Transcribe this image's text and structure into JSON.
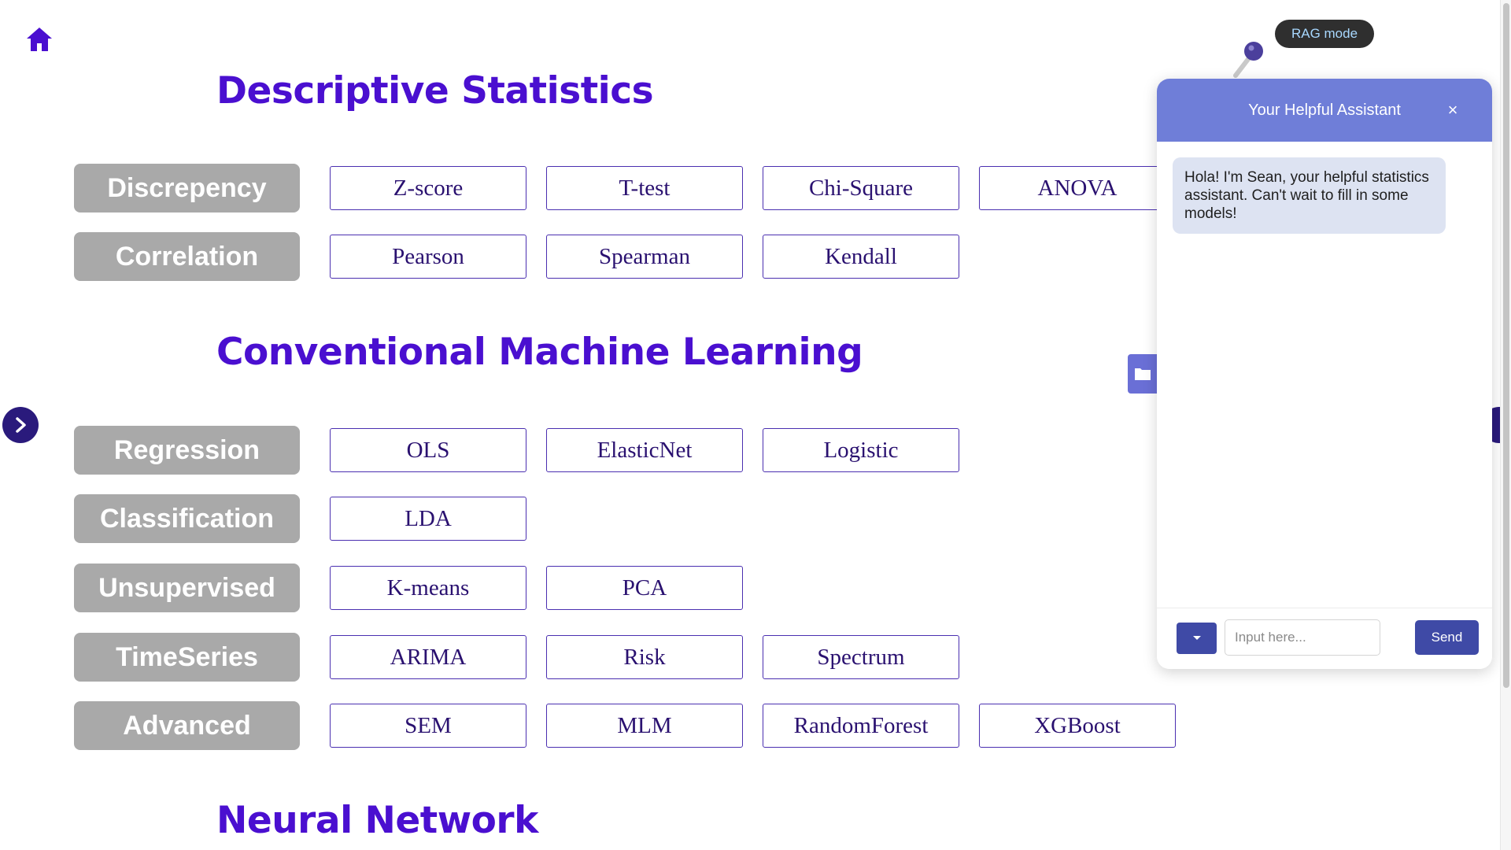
{
  "home": {
    "icon": "home-icon"
  },
  "sections": {
    "descriptive": "Descriptive Statistics",
    "conventional": "Conventional Machine Learning",
    "neural": "Neural Network"
  },
  "rows": {
    "discrepency": {
      "label": "Discrepency",
      "models": [
        "Z-score",
        "T-test",
        "Chi-Square",
        "ANOVA"
      ]
    },
    "correlation": {
      "label": "Correlation",
      "models": [
        "Pearson",
        "Spearman",
        "Kendall"
      ]
    },
    "regression": {
      "label": "Regression",
      "models": [
        "OLS",
        "ElasticNet",
        "Logistic"
      ]
    },
    "classification": {
      "label": "Classification",
      "models": [
        "LDA"
      ]
    },
    "unsupervised": {
      "label": "Unsupervised",
      "models": [
        "K-means",
        "PCA"
      ]
    },
    "timeseries": {
      "label": "TimeSeries",
      "models": [
        "ARIMA",
        "Risk",
        "Spectrum"
      ]
    },
    "advanced": {
      "label": "Advanced",
      "models": [
        "SEM",
        "MLM",
        "RandomForest",
        "XGBoost"
      ]
    }
  },
  "rag": {
    "label": "RAG mode"
  },
  "chat": {
    "title": "Your Helpful Assistant",
    "close": "×",
    "message": "Hola! I'm Sean, your helpful statistics assistant. Can't wait to fill in some models!",
    "input_placeholder": "Input here...",
    "input_value": "",
    "send_label": "Send"
  },
  "colors": {
    "accent": "#4a0fd0",
    "category": "#a9a9a9",
    "chat_header": "#6f7ed8",
    "chat_button": "#3f4aa6"
  }
}
